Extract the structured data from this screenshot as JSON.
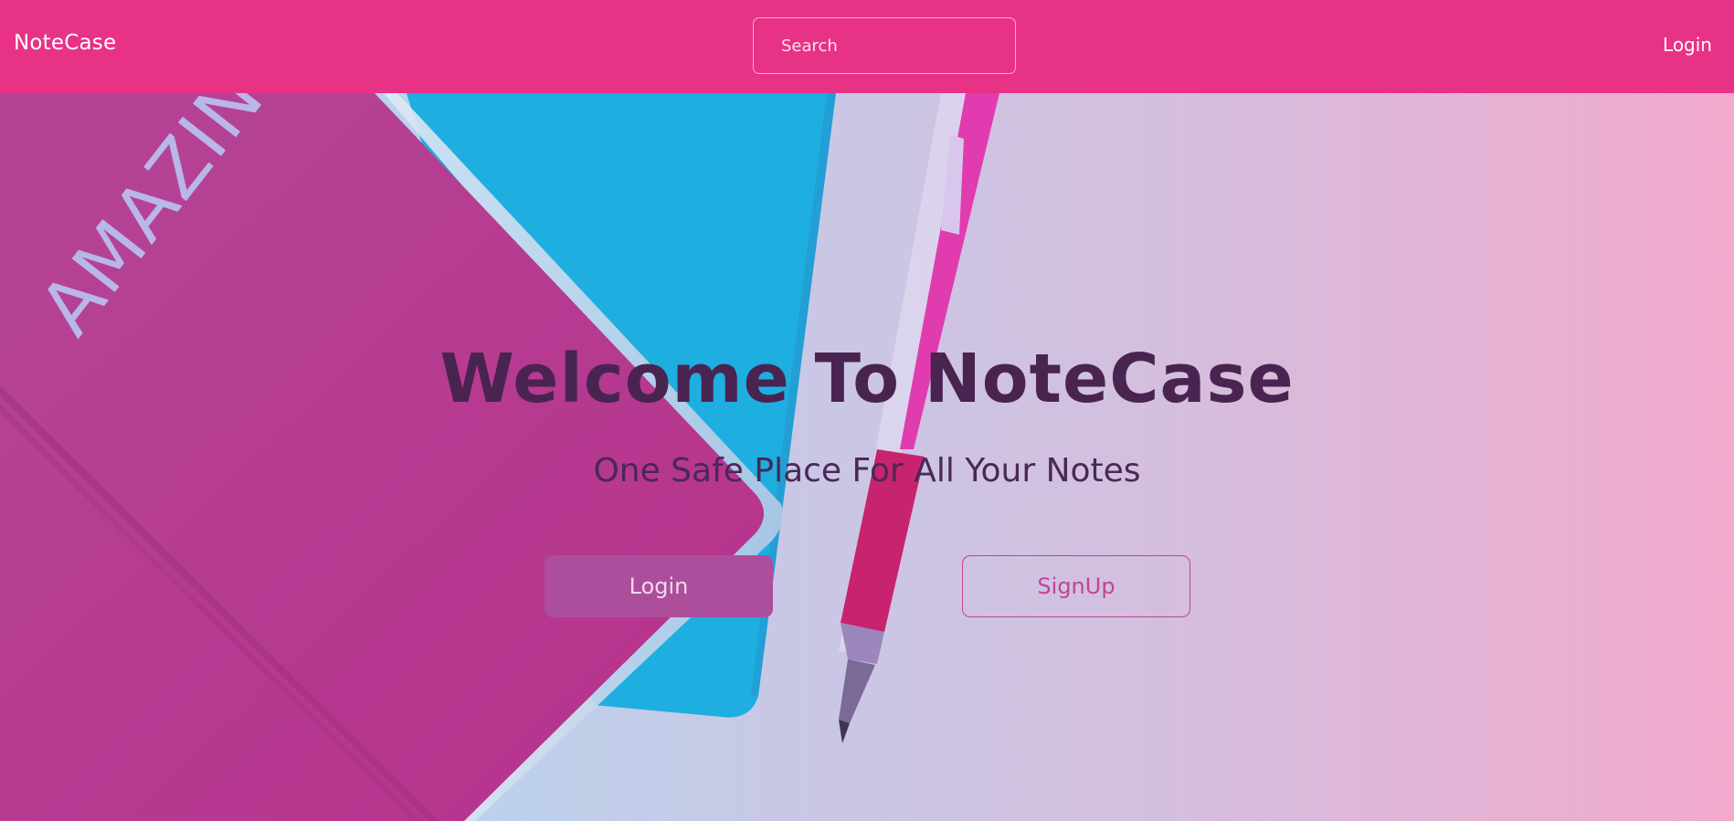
{
  "navbar": {
    "brand": "NoteCase",
    "search_placeholder": "Search",
    "login_label": "Login"
  },
  "hero": {
    "title": "Welcome To NoteCase",
    "subtitle": "One Safe Place For All Your Notes",
    "login_button": "Login",
    "signup_button": "SignUp",
    "notebook_lettering": "AMAZING"
  },
  "colors": {
    "navbar": "#e83285",
    "notebook": "#b8358f",
    "folder": "#1eaee0",
    "title_text": "#4a2450",
    "login_button": "#ac4e9c",
    "signup_border": "#c2449a"
  }
}
